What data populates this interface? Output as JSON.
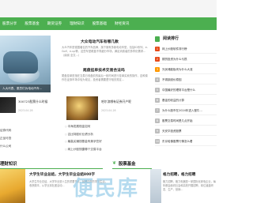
{
  "nav": [
    "股票分享",
    "股票基金",
    "期货证券",
    "理财知识",
    "股票基础",
    "财经资讯"
  ],
  "hero": {
    "caption": "人大代表、委员们为电动汽车…"
  },
  "headline1": {
    "title": "大众电动汽车有哪几款",
    "summary": "大众汽车是德国著名的汽车品牌，旗下拥有多款电动车型，包括ID系列、e-Golf、e-up等，这些车型覆盖不同细分市场，满足消费者的多样化需求…（续阅 全文…）"
  },
  "headline2": {
    "title": "尾盘挂单技术交易合法吗",
    "summary": "尾盘挂单是指在交易日收盘前的最后一段时间进行挂单买卖的操作，这种操作在证券市场中较为常见，投资者需要遵守相关规定…"
  },
  "thumb1": {
    "title": "300723股票什么时候",
    "date": "2023-04-28"
  },
  "thumb2": {
    "title": "哈尔滨哪有证券开户呢",
    "date": "2023-04-28"
  },
  "left_list": [
    "证券代码",
    "正品可查",
    "什么公司"
  ],
  "mid_list": [
    "中海发展现金如何",
    "吉比特股价业绩分析",
    "最高买赚钱基金有美孚些好",
    "网上炒股快捷哪个交易平台"
  ],
  "sidebar": {
    "title": "阅读排行",
    "items": [
      "网上炒股软件排行榜",
      "期货投资为什么亏损",
      "光伏储能板块为什么大涨",
      "不锈钢涨价原因",
      "中国最好的理财平台是什么",
      "基金的收益的计算",
      "为什么股市在2024年进入慢牛…",
      "股票交易时间是几点开始",
      "天安华投资股票",
      "东京哈佛股票行情怎么看"
    ]
  },
  "sec1": {
    "title": "理财知识"
  },
  "sec2": {
    "title": "股票基金"
  },
  "bot1": {
    "title": "大学生毕业总结，大学生毕业总结800字",
    "summary": "大学生毕业总结，大学毕业是人生的重要节点，回顾四年的学习生活，收获颇丰，从学业到社团活动…"
  },
  "bot2": {
    "title": "格力招聘，格力招聘",
    "summary": "格力招聘，格力电器是一家国际化家电企业，每年都会面向社会和高校开展招聘，岗位涵盖研发、生产、营销…"
  },
  "watermark": "便民库"
}
